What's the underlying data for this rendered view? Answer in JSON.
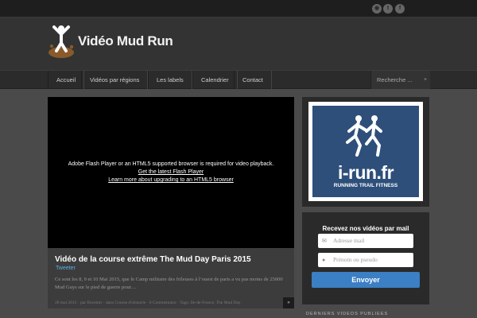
{
  "site": {
    "name": "Vidéo Mud Run",
    "social_icons": [
      "rss-icon",
      "twitter-icon",
      "facebook-icon"
    ]
  },
  "nav": {
    "items": [
      "Accueil",
      "Vidéos par régions",
      "Les labels",
      "Calendrier",
      "Contact"
    ],
    "search_placeholder": "Recherche ..."
  },
  "video": {
    "message": "Adobe Flash Player or an HTML5 supported browser is required for video playback.",
    "link1": "Get the latest Flash Player",
    "link2": "Learn more about upgrading to an HTML5 browser"
  },
  "post": {
    "title": "Vidéo de la course extrême The Mud Day Paris 2015",
    "tweet": "Tweeter",
    "excerpt": "Ce sont les 8, 9 et 10 Mai 2015, que le Camp militaire des frileuses à l’ouest de paris a vu pas moins de 25000 Mud Guys sur le pied de guerre pour…",
    "meta": "28 mai 2015 · par Ilovemir · dans Course d'obstacle · 0 Commentaire · Tags: Ile-de-France, The Mud Day",
    "more": "»"
  },
  "ad": {
    "brand": "i-run.fr",
    "tagline": "RUNNING TRAIL FITNESS"
  },
  "newsletter": {
    "title": "Recevez nos vidéos par mail",
    "email_placeholder": "Adresse mail",
    "name_placeholder": "Prénom ou pseudo",
    "button": "Envoyer"
  },
  "widget_title": "DERNIERS VIDEOS PUBLIEES"
}
